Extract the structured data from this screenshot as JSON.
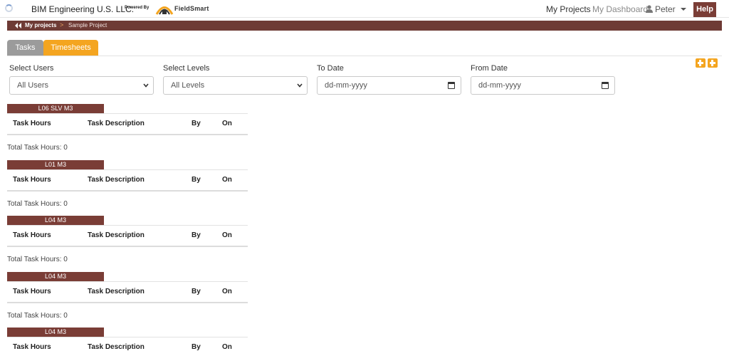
{
  "header": {
    "company": "BIM Engineering U.S. LLC.",
    "powered_by": "Powered By",
    "brand": "FieldSmart",
    "nav": {
      "my_projects": "My Projects",
      "my_dashboard": "My Dashboard",
      "user": "Peter",
      "help": "Help"
    }
  },
  "breadcrumb": {
    "my_projects": "My projects",
    "separator": ">",
    "current": "Sample Project"
  },
  "tabs": [
    {
      "label": "Tasks",
      "active": false
    },
    {
      "label": "Timesheets",
      "active": true
    }
  ],
  "filters": {
    "users": {
      "label": "Select Users",
      "value": "All Users"
    },
    "levels": {
      "label": "Select Levels",
      "value": "All Levels"
    },
    "to_date": {
      "label": "To Date",
      "placeholder": "dd-mm-yyyy"
    },
    "from_date": {
      "label": "From Date",
      "placeholder": "dd-mm-yyyy"
    }
  },
  "table_headers": {
    "task_hours": "Task Hours",
    "task_description": "Task Description",
    "by": "By",
    "on": "On"
  },
  "levels": [
    {
      "name": "L06 SLV M3",
      "total": "Total Task Hours: 0"
    },
    {
      "name": "L01 M3",
      "total": "Total Task Hours: 0"
    },
    {
      "name": "L04 M3",
      "total": "Total Task Hours: 0"
    },
    {
      "name": "L04 M3",
      "total": "Total Task Hours: 0"
    },
    {
      "name": "L04 M3",
      "total": ""
    }
  ],
  "colors": {
    "brand_brown": "#7a3d36",
    "accent_orange": "#f4a520",
    "tab_gray": "#9b9b9b"
  }
}
